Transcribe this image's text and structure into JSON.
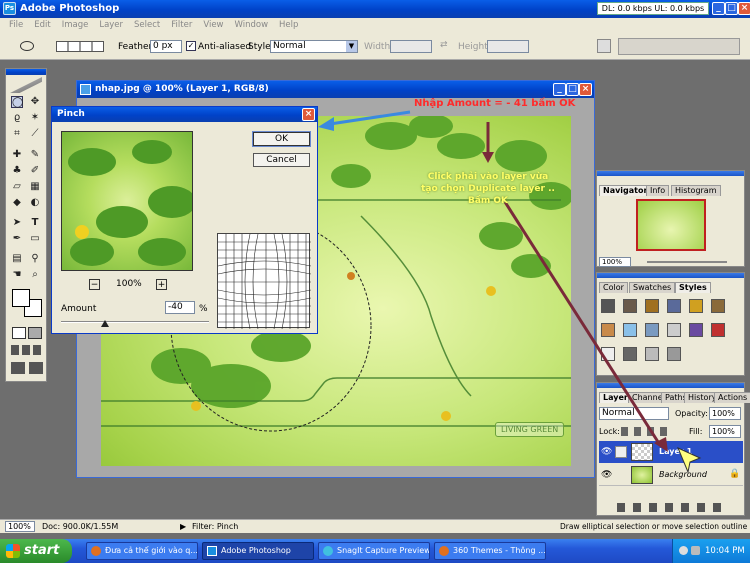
{
  "app": {
    "title": "Adobe Photoshop",
    "menu": [
      "File",
      "Edit",
      "Image",
      "Layer",
      "Select",
      "Filter",
      "View",
      "Window",
      "Help"
    ],
    "network": "DL: 0.0 kbps  UL: 0.0 kbps"
  },
  "options": {
    "feather_label": "Feather:",
    "feather_value": "0 px",
    "anti_aliased": "Anti-aliased",
    "style_label": "Style:",
    "style_value": "Normal",
    "width_label": "Width:",
    "height_label": "Height:"
  },
  "document": {
    "title": "nhap.jpg @ 100% (Layer 1, RGB/8)",
    "badge": "LIVING GREEN"
  },
  "pinch": {
    "title": "Pinch",
    "ok": "OK",
    "cancel": "Cancel",
    "zoom": "100%",
    "amount_label": "Amount",
    "amount_value": "-40",
    "percent": "%",
    "minus": "−",
    "plus": "+"
  },
  "annotations": {
    "top": "Nhập Amount = - 41 bấm OK",
    "right": "Click phải vào layer vừa tạo chọn Duplicate layer .. Bấm OK"
  },
  "navigator": {
    "tabs": [
      "Navigator",
      "Info",
      "Histogram"
    ],
    "zoom": "100%"
  },
  "styles": {
    "tabs": [
      "Color",
      "Swatches",
      "Styles"
    ]
  },
  "layers": {
    "tabs": [
      "Layers",
      "Channels",
      "Paths",
      "History",
      "Actions"
    ],
    "blend": "Normal",
    "opacity_label": "Opacity:",
    "opacity": "100%",
    "lock_label": "Lock:",
    "fill_label": "Fill:",
    "fill": "100%",
    "items": [
      "Layer 1",
      "Background"
    ]
  },
  "status": {
    "zoom": "100%",
    "doc": "Doc: 900.0K/1.55M",
    "filter": "Filter: Pinch",
    "hint": "Draw elliptical selection or move selection outline.  Use S"
  },
  "taskbar": {
    "start": "start",
    "tasks": [
      "Đưa cả thế giới vào q...",
      "Adobe Photoshop",
      "SnagIt Capture Preview",
      "360 Themes - Thông ..."
    ],
    "time": "10:04 PM"
  },
  "colors": {
    "title_blue": "#0a4fd8",
    "leaf_green": "#7fc23a",
    "annot_red": "#ff2a2a",
    "annot_yellow": "#ffff66"
  }
}
